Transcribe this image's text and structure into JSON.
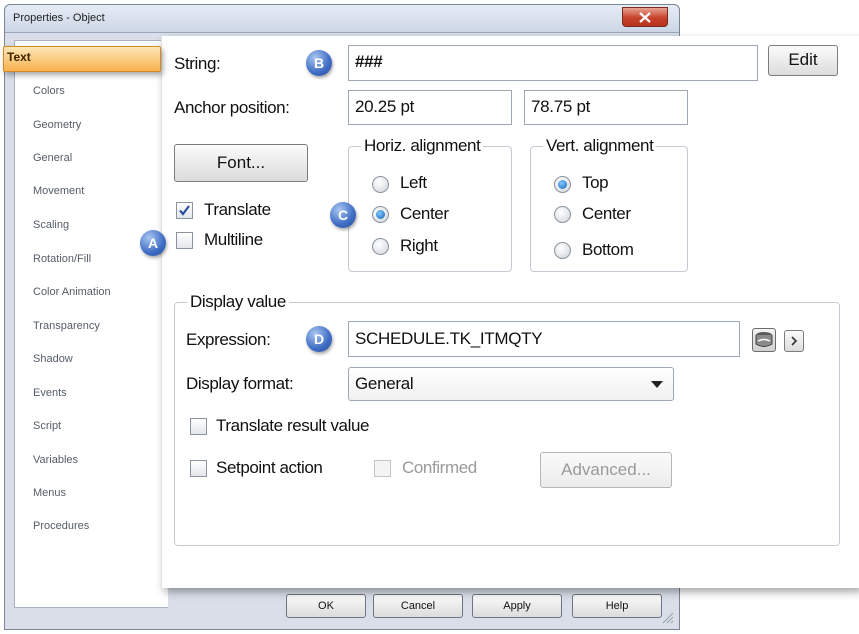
{
  "window": {
    "title": "Properties - Object"
  },
  "nav": {
    "active": "Text",
    "items": [
      "Colors",
      "Geometry",
      "General",
      "Movement",
      "Scaling",
      "Rotation/Fill",
      "Color Animation",
      "Transparency",
      "Shadow",
      "Events",
      "Script",
      "Variables",
      "Menus",
      "Procedures"
    ]
  },
  "text_panel": {
    "string_label": "String:",
    "string_value": "###",
    "edit_button": "Edit",
    "anchor_label": "Anchor position:",
    "anchor_x": "20.25 pt",
    "anchor_y": "78.75 pt",
    "font_button": "Font...",
    "translate_label": "Translate",
    "translate_checked": true,
    "multiline_label": "Multiline",
    "multiline_checked": false,
    "horiz_group": "Horiz. alignment",
    "horiz_options": [
      "Left",
      "Center",
      "Right"
    ],
    "horiz_selected": "Center",
    "vert_group": "Vert. alignment",
    "vert_options": [
      "Top",
      "Center",
      "Bottom"
    ],
    "vert_selected": "Top"
  },
  "display_value": {
    "group": "Display value",
    "expression_label": "Expression:",
    "expression_value": "SCHEDULE.TK_ITMQTY",
    "format_label": "Display format:",
    "format_value": "General",
    "translate_result_label": "Translate result value",
    "setpoint_label": "Setpoint action",
    "confirmed_label": "Confirmed",
    "advanced_button": "Advanced..."
  },
  "callouts": {
    "a": "A",
    "b": "B",
    "c": "C",
    "d": "D"
  },
  "footer": {
    "ok": "OK",
    "cancel": "Cancel",
    "apply": "Apply",
    "help": "Help"
  },
  "colors": {
    "accent_tab": "#f8b14e",
    "badge": "#3e6cc4",
    "close": "#c7422a"
  }
}
